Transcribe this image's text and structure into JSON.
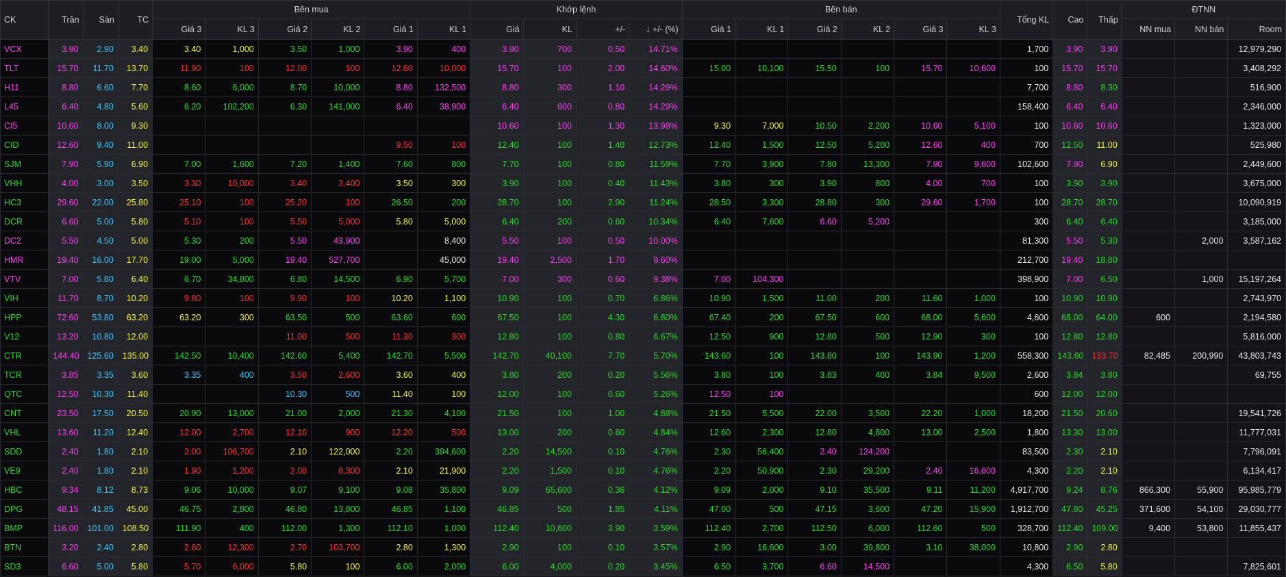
{
  "colors": {
    "ceiling": "#ff3cf3",
    "floor": "#3cc8ff",
    "reference": "#f6f634",
    "up": "#22dd22",
    "down": "#ff2e2e",
    "neutral": "#e8e8e8"
  },
  "headers": {
    "ck": "CK",
    "tran": "Trần",
    "san": "Sàn",
    "tc": "TC",
    "ben_mua": "Bên mua",
    "khop_lenh": "Khớp lệnh",
    "ben_ban": "Bên bán",
    "tong_kl": "Tổng KL",
    "cao": "Cao",
    "thap": "Thấp",
    "dtnn": "ĐTNN",
    "gia3": "Giá 3",
    "kl3": "KL 3",
    "gia2": "Giá 2",
    "kl2": "KL 2",
    "gia1": "Giá 1",
    "kl1": "KL 1",
    "gia": "Giá",
    "kl": "KL",
    "change": "+/-",
    "pct": "+/- (%)",
    "sort_icon": "↓",
    "nn_mua": "NN mua",
    "nn_ban": "NN bán",
    "room": "Room"
  },
  "rows": [
    {
      "ck": "VCX",
      "tran": "3.90",
      "san": "2.90",
      "tc": "3.40",
      "bg3": "3.40",
      "bk3": "1,000",
      "bg2": "3.50",
      "bk2": "1,000",
      "bg1": "3.90",
      "bk1": "400",
      "gia": "3.90",
      "kl": "700",
      "chg": "0.50",
      "pct": "14.71%",
      "sg1": "",
      "sk1": "",
      "sg2": "",
      "sk2": "",
      "sg3": "",
      "sk3": "",
      "tot": "1,700",
      "cao": "3.90",
      "thap": "3.90",
      "nnm": "",
      "nnb": "",
      "room": "12,979,290"
    },
    {
      "ck": "TLT",
      "tran": "15.70",
      "san": "11.70",
      "tc": "13.70",
      "bg3": "11.90",
      "bk3": "100",
      "bg2": "12.00",
      "bk2": "100",
      "bg1": "12.60",
      "bk1": "10,000",
      "gia": "15.70",
      "kl": "100",
      "chg": "2.00",
      "pct": "14.60%",
      "sg1": "15.00",
      "sk1": "10,100",
      "sg2": "15.50",
      "sk2": "100",
      "sg3": "15.70",
      "sk3": "10,600",
      "tot": "100",
      "cao": "15.70",
      "thap": "15.70",
      "nnm": "",
      "nnb": "",
      "room": "3,408,292"
    },
    {
      "ck": "H11",
      "tran": "8.80",
      "san": "6.60",
      "tc": "7.70",
      "bg3": "8.60",
      "bk3": "6,000",
      "bg2": "8.70",
      "bk2": "10,000",
      "bg1": "8.80",
      "bk1": "132,500",
      "gia": "8.80",
      "kl": "300",
      "chg": "1.10",
      "pct": "14.29%",
      "sg1": "",
      "sk1": "",
      "sg2": "",
      "sk2": "",
      "sg3": "",
      "sk3": "",
      "tot": "7,700",
      "cao": "8.80",
      "thap": "8.30",
      "nnm": "",
      "nnb": "",
      "room": "516,900"
    },
    {
      "ck": "L45",
      "tran": "6.40",
      "san": "4.80",
      "tc": "5.60",
      "bg3": "6.20",
      "bk3": "102,200",
      "bg2": "6.30",
      "bk2": "141,000",
      "bg1": "6.40",
      "bk1": "38,900",
      "gia": "6.40",
      "kl": "600",
      "chg": "0.80",
      "pct": "14.29%",
      "sg1": "",
      "sk1": "",
      "sg2": "",
      "sk2": "",
      "sg3": "",
      "sk3": "",
      "tot": "158,400",
      "cao": "6.40",
      "thap": "6.40",
      "nnm": "",
      "nnb": "",
      "room": "2,346,000"
    },
    {
      "ck": "CI5",
      "tran": "10.60",
      "san": "8.00",
      "tc": "9.30",
      "bg3": "",
      "bk3": "",
      "bg2": "",
      "bk2": "",
      "bg1": "",
      "bk1": "",
      "gia": "10.60",
      "kl": "100",
      "chg": "1.30",
      "pct": "13.98%",
      "sg1": "9.30",
      "sk1": "7,000",
      "sg2": "10.50",
      "sk2": "2,200",
      "sg3": "10.60",
      "sk3": "5,100",
      "tot": "100",
      "cao": "10.60",
      "thap": "10.60",
      "nnm": "",
      "nnb": "",
      "room": "1,323,000"
    },
    {
      "ck": "CID",
      "tran": "12.60",
      "san": "9.40",
      "tc": "11.00",
      "bg3": "",
      "bk3": "",
      "bg2": "",
      "bk2": "",
      "bg1": "9.50",
      "bk1": "100",
      "gia": "12.40",
      "kl": "100",
      "chg": "1.40",
      "pct": "12.73%",
      "sg1": "12.40",
      "sk1": "1,500",
      "sg2": "12.50",
      "sk2": "5,200",
      "sg3": "12.60",
      "sk3": "400",
      "tot": "700",
      "cao": "12.50",
      "thap": "11.00",
      "nnm": "",
      "nnb": "",
      "room": "525,980"
    },
    {
      "ck": "SJM",
      "tran": "7.90",
      "san": "5.90",
      "tc": "6.90",
      "bg3": "7.00",
      "bk3": "1,600",
      "bg2": "7.20",
      "bk2": "1,400",
      "bg1": "7.60",
      "bk1": "800",
      "gia": "7.70",
      "kl": "100",
      "chg": "0.80",
      "pct": "11.59%",
      "sg1": "7.70",
      "sk1": "3,900",
      "sg2": "7.80",
      "sk2": "13,300",
      "sg3": "7.90",
      "sk3": "9,600",
      "tot": "102,600",
      "cao": "7.90",
      "thap": "6.90",
      "nnm": "",
      "nnb": "",
      "room": "2,449,600"
    },
    {
      "ck": "VHH",
      "tran": "4.00",
      "san": "3.00",
      "tc": "3.50",
      "bg3": "3.30",
      "bk3": "10,000",
      "bg2": "3.40",
      "bk2": "3,400",
      "bg1": "3.50",
      "bk1": "300",
      "gia": "3.90",
      "kl": "100",
      "chg": "0.40",
      "pct": "11.43%",
      "sg1": "3.80",
      "sk1": "300",
      "sg2": "3.90",
      "sk2": "800",
      "sg3": "4.00",
      "sk3": "700",
      "tot": "100",
      "cao": "3.90",
      "thap": "3.90",
      "nnm": "",
      "nnb": "",
      "room": "3,675,000"
    },
    {
      "ck": "HC3",
      "tran": "29.60",
      "san": "22.00",
      "tc": "25.80",
      "bg3": "25.10",
      "bk3": "100",
      "bg2": "25.20",
      "bk2": "100",
      "bg1": "26.50",
      "bk1": "200",
      "gia": "28.70",
      "kl": "100",
      "chg": "2.90",
      "pct": "11.24%",
      "sg1": "28.50",
      "sk1": "3,300",
      "sg2": "28.80",
      "sk2": "300",
      "sg3": "29.60",
      "sk3": "1,700",
      "tot": "100",
      "cao": "28.70",
      "thap": "28.70",
      "nnm": "",
      "nnb": "",
      "room": "10,090,919"
    },
    {
      "ck": "DCR",
      "tran": "6.60",
      "san": "5.00",
      "tc": "5.80",
      "bg3": "5.10",
      "bk3": "100",
      "bg2": "5.50",
      "bk2": "5,000",
      "bg1": "5.80",
      "bk1": "5,000",
      "gia": "6.40",
      "kl": "200",
      "chg": "0.60",
      "pct": "10.34%",
      "sg1": "6.40",
      "sk1": "7,600",
      "sg2": "6.60",
      "sk2": "5,200",
      "sg3": "",
      "sk3": "",
      "tot": "300",
      "cao": "6.40",
      "thap": "6.40",
      "nnm": "",
      "nnb": "",
      "room": "3,185,000"
    },
    {
      "ck": "DC2",
      "tran": "5.50",
      "san": "4.50",
      "tc": "5.00",
      "bg3": "5.30",
      "bk3": "200",
      "bg2": "5.50",
      "bk2": "43,900",
      "bg1": "",
      "bk1": "8,400",
      "gia": "5.50",
      "kl": "100",
      "chg": "0.50",
      "pct": "10.00%",
      "sg1": "",
      "sk1": "",
      "sg2": "",
      "sk2": "",
      "sg3": "",
      "sk3": "",
      "tot": "81,300",
      "cao": "5.50",
      "thap": "5.30",
      "nnm": "",
      "nnb": "2,000",
      "room": "3,587,162"
    },
    {
      "ck": "HMR",
      "tran": "19.40",
      "san": "16.00",
      "tc": "17.70",
      "bg3": "19.00",
      "bk3": "5,000",
      "bg2": "19.40",
      "bk2": "527,700",
      "bg1": "",
      "bk1": "45,000",
      "gia": "19.40",
      "kl": "2,500",
      "chg": "1.70",
      "pct": "9.60%",
      "sg1": "",
      "sk1": "",
      "sg2": "",
      "sk2": "",
      "sg3": "",
      "sk3": "",
      "tot": "212,700",
      "cao": "19.40",
      "thap": "18.80",
      "nnm": "",
      "nnb": "",
      "room": ""
    },
    {
      "ck": "VTV",
      "tran": "7.00",
      "san": "5.80",
      "tc": "6.40",
      "bg3": "6.70",
      "bk3": "34,800",
      "bg2": "6.80",
      "bk2": "14,500",
      "bg1": "6.90",
      "bk1": "5,700",
      "gia": "7.00",
      "kl": "300",
      "chg": "0.60",
      "pct": "9.38%",
      "sg1": "7.00",
      "sk1": "104,300",
      "sg2": "",
      "sk2": "",
      "sg3": "",
      "sk3": "",
      "tot": "398,900",
      "cao": "7.00",
      "thap": "6.50",
      "nnm": "",
      "nnb": "1,000",
      "room": "15,197,264"
    },
    {
      "ck": "VIH",
      "tran": "11.70",
      "san": "8.70",
      "tc": "10.20",
      "bg3": "9.80",
      "bk3": "100",
      "bg2": "9.90",
      "bk2": "100",
      "bg1": "10.20",
      "bk1": "1,100",
      "gia": "10.90",
      "kl": "100",
      "chg": "0.70",
      "pct": "6.86%",
      "sg1": "10.90",
      "sk1": "1,500",
      "sg2": "11.00",
      "sk2": "200",
      "sg3": "11.60",
      "sk3": "1,000",
      "tot": "100",
      "cao": "10.90",
      "thap": "10.90",
      "nnm": "",
      "nnb": "",
      "room": "2,743,970"
    },
    {
      "ck": "HPP",
      "tran": "72.60",
      "san": "53.80",
      "tc": "63.20",
      "bg3": "63.20",
      "bk3": "300",
      "bg2": "63.50",
      "bk2": "500",
      "bg1": "63.60",
      "bk1": "600",
      "gia": "67.50",
      "kl": "100",
      "chg": "4.30",
      "pct": "6.80%",
      "sg1": "67.40",
      "sk1": "200",
      "sg2": "67.50",
      "sk2": "600",
      "sg3": "68.00",
      "sk3": "5,600",
      "tot": "4,600",
      "cao": "68.00",
      "thap": "64.00",
      "nnm": "600",
      "nnb": "",
      "room": "2,194,580"
    },
    {
      "ck": "V12",
      "tran": "13.20",
      "san": "10.80",
      "tc": "12.00",
      "bg3": "",
      "bk3": "",
      "bg2": "11.00",
      "bk2": "500",
      "bg1": "11.30",
      "bk1": "300",
      "gia": "12.80",
      "kl": "100",
      "chg": "0.80",
      "pct": "6.67%",
      "sg1": "12.50",
      "sk1": "900",
      "sg2": "12.80",
      "sk2": "500",
      "sg3": "12.90",
      "sk3": "300",
      "tot": "100",
      "cao": "12.80",
      "thap": "12.80",
      "nnm": "",
      "nnb": "",
      "room": "5,816,000"
    },
    {
      "ck": "CTR",
      "tran": "144.40",
      "san": "125.60",
      "tc": "135.00",
      "bg3": "142.50",
      "bk3": "10,400",
      "bg2": "142.60",
      "bk2": "5,400",
      "bg1": "142.70",
      "bk1": "5,500",
      "gia": "142.70",
      "kl": "40,100",
      "chg": "7.70",
      "pct": "5.70%",
      "sg1": "143.60",
      "sk1": "100",
      "sg2": "143.80",
      "sk2": "100",
      "sg3": "143.90",
      "sk3": "1,200",
      "tot": "558,300",
      "cao": "143.60",
      "thap": "133.70",
      "nnm": "82,485",
      "nnb": "200,990",
      "room": "43,803,743"
    },
    {
      "ck": "TCR",
      "tran": "3.85",
      "san": "3.35",
      "tc": "3.60",
      "bg3": "3.35",
      "bk3": "400",
      "bg2": "3.50",
      "bk2": "2,600",
      "bg1": "3.60",
      "bk1": "400",
      "gia": "3.80",
      "kl": "200",
      "chg": "0.20",
      "pct": "5.56%",
      "sg1": "3.80",
      "sk1": "100",
      "sg2": "3.83",
      "sk2": "400",
      "sg3": "3.84",
      "sk3": "9,500",
      "tot": "2,600",
      "cao": "3.84",
      "thap": "3.80",
      "nnm": "",
      "nnb": "",
      "room": "69,755"
    },
    {
      "ck": "QTC",
      "tran": "12.50",
      "san": "10.30",
      "tc": "11.40",
      "bg3": "",
      "bk3": "",
      "bg2": "10.30",
      "bk2": "500",
      "bg1": "11.40",
      "bk1": "100",
      "gia": "12.00",
      "kl": "100",
      "chg": "0.60",
      "pct": "5.26%",
      "sg1": "12.50",
      "sk1": "100",
      "sg2": "",
      "sk2": "",
      "sg3": "",
      "sk3": "",
      "tot": "600",
      "cao": "12.00",
      "thap": "12.00",
      "nnm": "",
      "nnb": "",
      "room": ""
    },
    {
      "ck": "CNT",
      "tran": "23.50",
      "san": "17.50",
      "tc": "20.50",
      "bg3": "20.90",
      "bk3": "13,000",
      "bg2": "21.00",
      "bk2": "2,000",
      "bg1": "21.30",
      "bk1": "4,100",
      "gia": "21.50",
      "kl": "100",
      "chg": "1.00",
      "pct": "4.88%",
      "sg1": "21.50",
      "sk1": "5,500",
      "sg2": "22.00",
      "sk2": "3,500",
      "sg3": "22.20",
      "sk3": "1,000",
      "tot": "18,200",
      "cao": "21.50",
      "thap": "20.60",
      "nnm": "",
      "nnb": "",
      "room": "19,541,726"
    },
    {
      "ck": "VHL",
      "tran": "13.60",
      "san": "11.20",
      "tc": "12.40",
      "bg3": "12.00",
      "bk3": "2,700",
      "bg2": "12.10",
      "bk2": "900",
      "bg1": "12.20",
      "bk1": "500",
      "gia": "13.00",
      "kl": "200",
      "chg": "0.60",
      "pct": "4.84%",
      "sg1": "12.60",
      "sk1": "2,300",
      "sg2": "12.80",
      "sk2": "4,800",
      "sg3": "13.00",
      "sk3": "2,500",
      "tot": "1,800",
      "cao": "13.30",
      "thap": "13.00",
      "nnm": "",
      "nnb": "",
      "room": "11,777,031"
    },
    {
      "ck": "SDD",
      "tran": "2.40",
      "san": "1.80",
      "tc": "2.10",
      "bg3": "2.00",
      "bk3": "106,700",
      "bg2": "2.10",
      "bk2": "122,000",
      "bg1": "2.20",
      "bk1": "394,600",
      "gia": "2.20",
      "kl": "14,500",
      "chg": "0.10",
      "pct": "4.76%",
      "sg1": "2.30",
      "sk1": "56,400",
      "sg2": "2.40",
      "sk2": "124,200",
      "sg3": "",
      "sk3": "",
      "tot": "83,500",
      "cao": "2.30",
      "thap": "2.10",
      "nnm": "",
      "nnb": "",
      "room": "7,796,091"
    },
    {
      "ck": "VE9",
      "tran": "2.40",
      "san": "1.80",
      "tc": "2.10",
      "bg3": "1.90",
      "bk3": "1,200",
      "bg2": "2.00",
      "bk2": "8,300",
      "bg1": "2.10",
      "bk1": "21,900",
      "gia": "2.20",
      "kl": "1,500",
      "chg": "0.10",
      "pct": "4.76%",
      "sg1": "2.20",
      "sk1": "50,900",
      "sg2": "2.30",
      "sk2": "29,200",
      "sg3": "2.40",
      "sk3": "16,600",
      "tot": "4,300",
      "cao": "2.20",
      "thap": "2.10",
      "nnm": "",
      "nnb": "",
      "room": "6,134,417"
    },
    {
      "ck": "HBC",
      "tran": "9.34",
      "san": "8.12",
      "tc": "8.73",
      "bg3": "9.06",
      "bk3": "10,000",
      "bg2": "9.07",
      "bk2": "9,100",
      "bg1": "9.08",
      "bk1": "35,800",
      "gia": "9.09",
      "kl": "65,600",
      "chg": "0.36",
      "pct": "4.12%",
      "sg1": "9.09",
      "sk1": "2,000",
      "sg2": "9.10",
      "sk2": "35,500",
      "sg3": "9.11",
      "sk3": "11,200",
      "tot": "4,917,700",
      "cao": "9.24",
      "thap": "8.76",
      "nnm": "866,300",
      "nnb": "55,900",
      "room": "95,985,779"
    },
    {
      "ck": "DPG",
      "tran": "48.15",
      "san": "41.85",
      "tc": "45.00",
      "bg3": "46.75",
      "bk3": "2,800",
      "bg2": "46.80",
      "bk2": "13,800",
      "bg1": "46.85",
      "bk1": "1,100",
      "gia": "46.85",
      "kl": "500",
      "chg": "1.85",
      "pct": "4.11%",
      "sg1": "47.00",
      "sk1": "500",
      "sg2": "47.15",
      "sk2": "3,600",
      "sg3": "47.20",
      "sk3": "15,900",
      "tot": "1,912,700",
      "cao": "47.80",
      "thap": "45.25",
      "nnm": "371,600",
      "nnb": "54,100",
      "room": "29,030,777"
    },
    {
      "ck": "BMP",
      "tran": "116.00",
      "san": "101.00",
      "tc": "108.50",
      "bg3": "111.90",
      "bk3": "400",
      "bg2": "112.00",
      "bk2": "1,300",
      "bg1": "112.10",
      "bk1": "1,000",
      "gia": "112.40",
      "kl": "10,600",
      "chg": "3.90",
      "pct": "3.59%",
      "sg1": "112.40",
      "sk1": "2,700",
      "sg2": "112.50",
      "sk2": "6,000",
      "sg3": "112.60",
      "sk3": "500",
      "tot": "328,700",
      "cao": "112.40",
      "thap": "109.00",
      "nnm": "9,400",
      "nnb": "53,800",
      "room": "11,855,437"
    },
    {
      "ck": "BTN",
      "tran": "3.20",
      "san": "2.40",
      "tc": "2.80",
      "bg3": "2.60",
      "bk3": "12,300",
      "bg2": "2.70",
      "bk2": "103,700",
      "bg1": "2.80",
      "bk1": "1,300",
      "gia": "2.90",
      "kl": "100",
      "chg": "0.10",
      "pct": "3.57%",
      "sg1": "2.90",
      "sk1": "16,600",
      "sg2": "3.00",
      "sk2": "39,800",
      "sg3": "3.10",
      "sk3": "38,000",
      "tot": "10,800",
      "cao": "2.90",
      "thap": "2.80",
      "nnm": "",
      "nnb": "",
      "room": ""
    },
    {
      "ck": "SD3",
      "tran": "6.60",
      "san": "5.00",
      "tc": "5.80",
      "bg3": "5.70",
      "bk3": "6,000",
      "bg2": "5.80",
      "bk2": "100",
      "bg1": "6.00",
      "bk1": "2,000",
      "gia": "6.00",
      "kl": "4,000",
      "chg": "0.20",
      "pct": "3.45%",
      "sg1": "6.50",
      "sk1": "3,700",
      "sg2": "6.60",
      "sk2": "14,500",
      "sg3": "",
      "sk3": "",
      "tot": "4,300",
      "cao": "6.50",
      "thap": "5.80",
      "nnm": "",
      "nnb": "",
      "room": "7,825,601"
    }
  ]
}
